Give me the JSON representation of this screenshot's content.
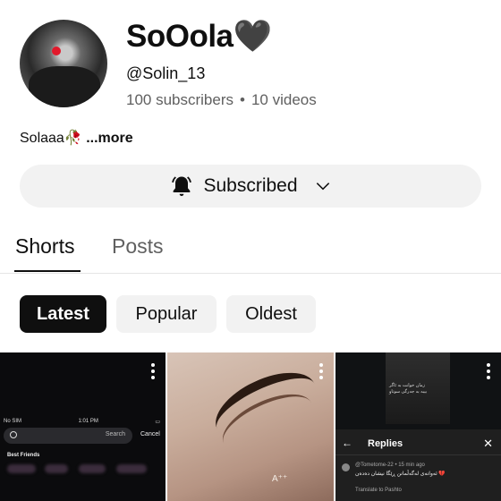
{
  "channel": {
    "name": "SoOola🖤",
    "handle": "@Solin_13",
    "subscribers": "100 subscribers",
    "separator": "•",
    "videos": "10 videos",
    "bio": "Solaaa🥀",
    "bio_more": "...more"
  },
  "subscribe": {
    "label": "Subscribed",
    "icon": "bell-ringing-icon",
    "chevron_icon": "chevron-down-icon"
  },
  "tabs": [
    {
      "label": "Shorts",
      "selected": true
    },
    {
      "label": "Posts",
      "selected": false
    }
  ],
  "filters": [
    {
      "label": "Latest",
      "selected": true
    },
    {
      "label": "Popular",
      "selected": false
    },
    {
      "label": "Oldest",
      "selected": false
    }
  ],
  "shorts": [
    {
      "status_left": "No SIM",
      "status_time": "1:01 PM",
      "search_placeholder": "Search",
      "cancel_label": "Cancel",
      "section_label": "Best Friends"
    },
    {
      "overlay_text": "A⁺⁺"
    },
    {
      "overlay_text": "زمان خوانت بە ئاگر\nبیبە بە جەرگی سوتاو",
      "panel_title": "Replies",
      "comment_meta": "@Tometome-22 • 15 min ago",
      "comment_text": "ئەوانەی لەگەڵمانن ڕێگا نیشان دەدەن 💔",
      "translate_label": "Translate to Pashto"
    }
  ],
  "colors": {
    "text": "#0f0f0f",
    "muted": "#606060",
    "chip_bg": "#f2f2f2",
    "chip_selected_bg": "#0f0f0f"
  }
}
